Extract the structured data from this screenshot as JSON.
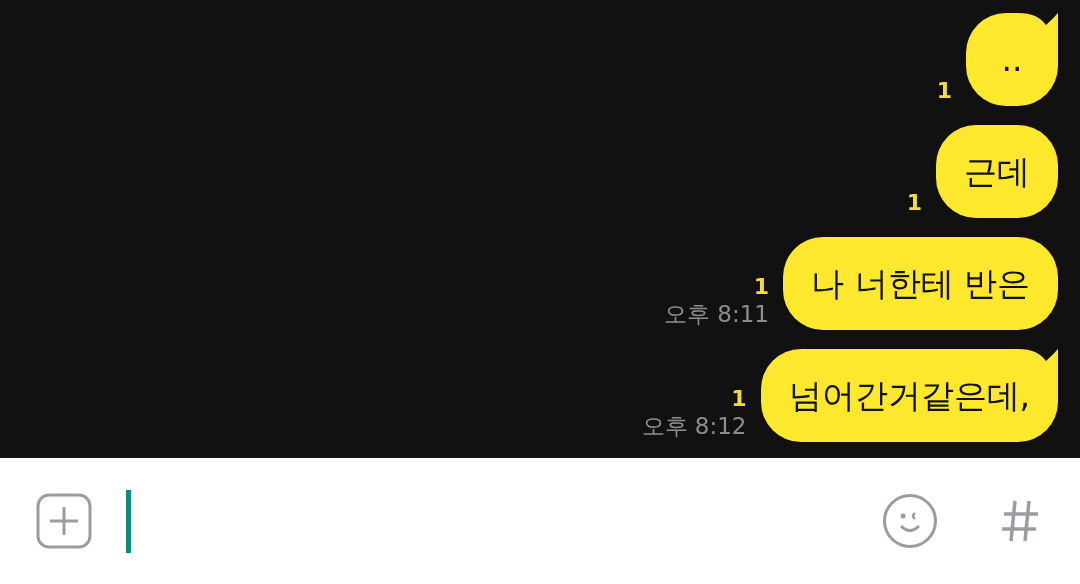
{
  "messages": [
    {
      "text": "..",
      "unread": "1",
      "tail": true
    },
    {
      "text": "근데",
      "unread": "1",
      "tail": false
    },
    {
      "text": "나 너한테 반은",
      "unread": "1",
      "time": "오후 8:11",
      "tail": false
    },
    {
      "text": "넘어간거같은데,",
      "unread": "1",
      "time": "오후 8:12",
      "tail": true
    }
  ],
  "composer": {
    "focused": true
  }
}
